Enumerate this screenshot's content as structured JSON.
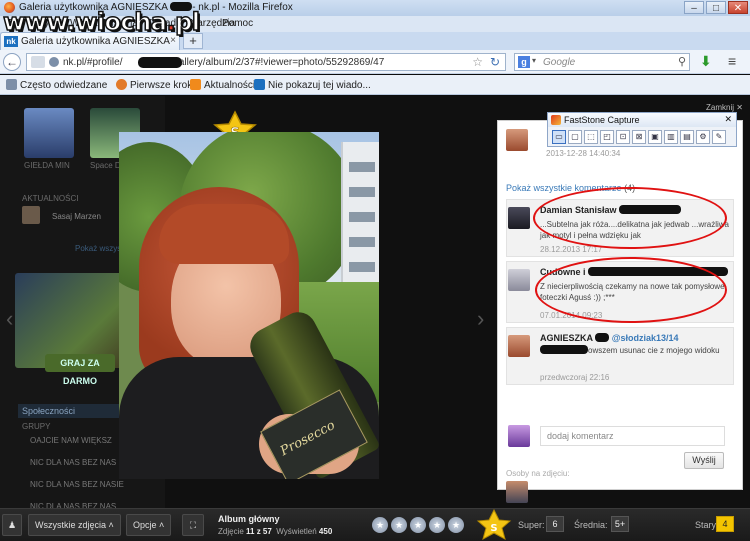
{
  "browser": {
    "window_title": "Galeria użytkownika AGNIESZKA",
    "window_title_suffix": "- nk.pl - Mozilla Firefox",
    "menu": [
      "Plik",
      "Edycja",
      "Widok",
      "Historia",
      "Zakładki",
      "Narzędzia",
      "Pomoc"
    ],
    "tab_label": "Galeria użytkownika AGNIESZKA",
    "tab_close": "×",
    "new_tab": "+",
    "url_prefix": "nk.pl/#profile/",
    "url_suffix": "/gallery/album/2/37#!viewer=photo/55292869/47",
    "search_placeholder": "Google",
    "bookmarks": [
      "Często odwiedzane",
      "Pierwsze kroki",
      "Aktualności",
      "Nie pokazuj tej wiado..."
    ],
    "window_buttons": [
      "–",
      "□",
      "✕"
    ]
  },
  "watermark": {
    "prefix": "www.wiocha",
    "dot": ".",
    "suffix": "pl"
  },
  "left_bg": {
    "labels": [
      "GIEŁDA MIN",
      "Space Dolls"
    ],
    "section_label": "AKTUALNOŚCI",
    "news_item": "Sasaj Marzen",
    "more_link": "Pokaż wszystkie",
    "game_button": "GRAJ ZA DARMO",
    "friends_header": "Społeczności",
    "group_label": "GRUPY",
    "items": [
      "OAJCIE NAM WIĘKSZ",
      "NIC DLA NAS BEZ NAS",
      "NIC DLA NAS BEZ NASIE",
      "NIC DLA NAS BEZ NAS"
    ]
  },
  "viewer": {
    "close_label": "Zamknij",
    "close_icon": "✕",
    "bottle_label": "Prosecco",
    "nav_prev": "‹",
    "nav_next": "›"
  },
  "comments": {
    "top_date": "2013-12-28 14:40:34",
    "show_all_label": "Pokaż wszystkie komentarze",
    "show_all_count": "(4)",
    "items": [
      {
        "author": "Damian Stanisław",
        "text": "...Subtelna jak róża....delikatna jak jedwab ...wrażliwa jak motyl i pełna wdzięku jak",
        "date": "28.12.2013 17:17"
      },
      {
        "author": "Cudowne i",
        "text_tail": "Z niecierpliwością czekamy na nowe tak pomysłowe foteczki Agusś :)) ;***",
        "date": "07.01.2014 09:23"
      },
      {
        "author": "AGNIESZKA",
        "reply_to": "@słodziak13/14",
        "text": "owszem usunac cie z mojego widoku",
        "date": "przedwczoraj 22:16"
      }
    ],
    "add_placeholder": "dodaj komentarz",
    "send_label": "Wyślij",
    "people_label": "Osoby na zdjęciu:"
  },
  "faststone": {
    "title": "FastStone Capture",
    "tools": [
      "▭",
      "▢",
      "⬚",
      "◰",
      "⊡",
      "⊠",
      "▣",
      "▥",
      "▤",
      "⚙",
      "✎"
    ],
    "close": "✕"
  },
  "bottom": {
    "all_photos": "Wszystkie zdjęcia",
    "options": "Opcje",
    "album_title": "Album główny",
    "photo_label": "Zdjęcie",
    "photo_pos": "11 z 57",
    "views_label": "Wyświetleń",
    "views": "450",
    "super_label": "Super:",
    "super_value": "6",
    "avg_label": "Średnia:",
    "avg_value": "5+",
    "old_label": "Stary",
    "old_value": "4",
    "star_letter": "S"
  },
  "colors": {
    "accent_link": "#3a7ab8",
    "highlight_oval": "#e01212",
    "badge_gold": "#f3c400"
  }
}
